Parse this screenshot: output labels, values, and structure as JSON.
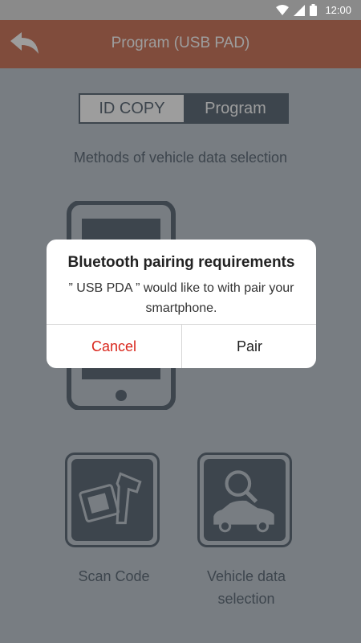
{
  "status_bar": {
    "time": "12:00",
    "icons": [
      "wifi-icon",
      "signal-icon",
      "battery-icon"
    ]
  },
  "app_bar": {
    "title": "Program (USB PAD)",
    "back_icon": "back-arrow-icon",
    "color": "#c45d3c"
  },
  "segment": {
    "options": [
      "ID COPY",
      "Program"
    ],
    "selected": "Program"
  },
  "methods": {
    "title": "Methods of vehicle data selection",
    "options": [
      {
        "label": "Scan Code",
        "icon": "barcode-scanner-icon"
      },
      {
        "label_line1": "Vehicle data",
        "label_line2": "selection",
        "icon": "car-search-icon"
      }
    ]
  },
  "dialog": {
    "title": "Bluetooth pairing requirements",
    "message": "” USB PDA ” would like to with pair your smartphone.",
    "cancel_label": "Cancel",
    "pair_label": "Pair",
    "cancel_color": "#d9261c"
  },
  "colors": {
    "primary_dark": "#3e4e5e",
    "accent": "#c45d3c"
  }
}
